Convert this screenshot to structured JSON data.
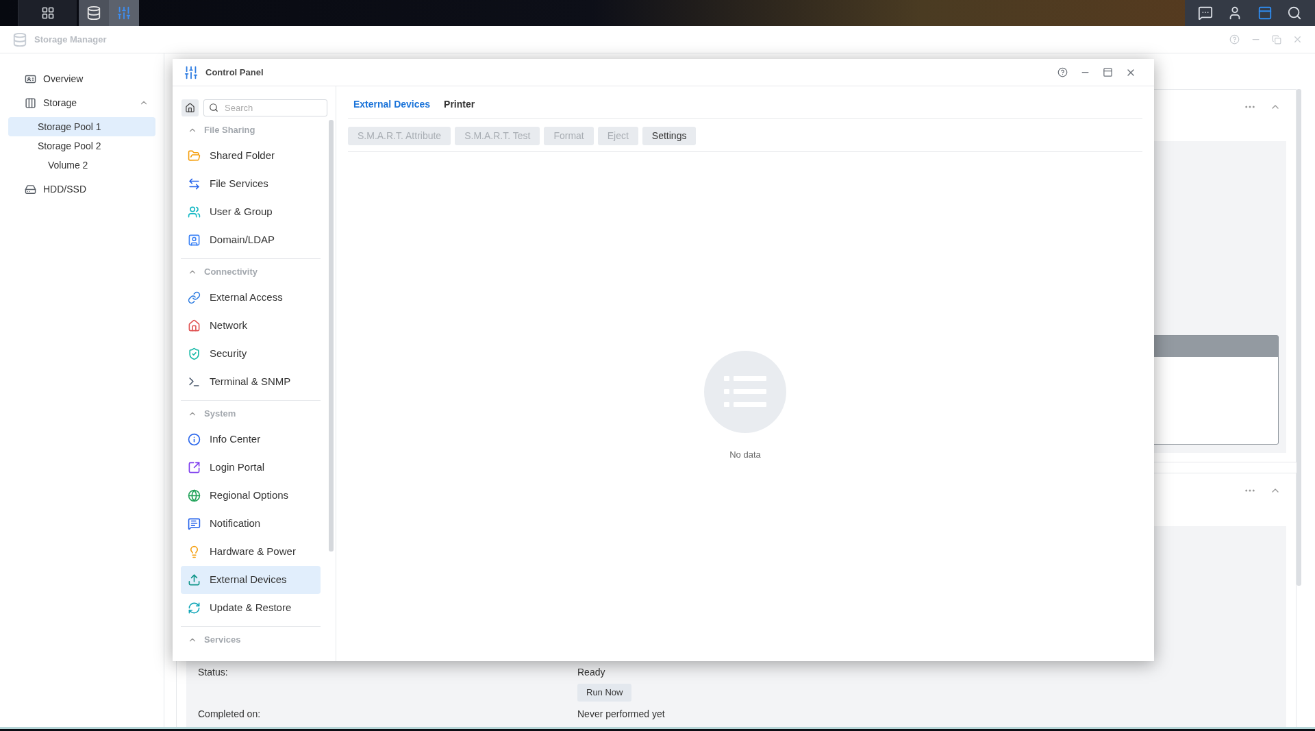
{
  "storage_manager": {
    "title": "Storage Manager",
    "sidebar": [
      {
        "label": "Overview",
        "selected": false
      },
      {
        "label": "Storage",
        "selected": false,
        "expanded": true,
        "children": [
          {
            "label": "Storage Pool 1",
            "selected": true
          },
          {
            "label": "Storage Pool 2",
            "selected": false,
            "children": [
              {
                "label": "Volume 2",
                "selected": false
              }
            ]
          }
        ]
      },
      {
        "label": "HDD/SSD",
        "selected": false
      }
    ],
    "details": [
      {
        "label": "Status:",
        "value": "Ready",
        "button": "Run Now"
      },
      {
        "label": "Completed on:",
        "value": "Never performed yet"
      }
    ]
  },
  "control_panel": {
    "title": "Control Panel",
    "search": {
      "placeholder": "Search"
    },
    "sections": [
      {
        "title": "File Sharing",
        "expanded": true,
        "items": [
          {
            "label": "Shared Folder",
            "selected": false
          },
          {
            "label": "File Services",
            "selected": false
          },
          {
            "label": "User & Group",
            "selected": false
          },
          {
            "label": "Domain/LDAP",
            "selected": false
          }
        ]
      },
      {
        "title": "Connectivity",
        "expanded": true,
        "items": [
          {
            "label": "External Access",
            "selected": false
          },
          {
            "label": "Network",
            "selected": false
          },
          {
            "label": "Security",
            "selected": false
          },
          {
            "label": "Terminal & SNMP",
            "selected": false
          }
        ]
      },
      {
        "title": "System",
        "expanded": true,
        "items": [
          {
            "label": "Info Center",
            "selected": false
          },
          {
            "label": "Login Portal",
            "selected": false
          },
          {
            "label": "Regional Options",
            "selected": false
          },
          {
            "label": "Notification",
            "selected": false
          },
          {
            "label": "Hardware & Power",
            "selected": false
          },
          {
            "label": "External Devices",
            "selected": true
          },
          {
            "label": "Update & Restore",
            "selected": false
          }
        ]
      },
      {
        "title": "Services",
        "expanded": true
      }
    ],
    "tabs": [
      {
        "label": "External Devices",
        "selected": true
      },
      {
        "label": "Printer",
        "selected": false
      }
    ],
    "toolbar": [
      {
        "label": "S.M.A.R.T. Attribute",
        "disabled": true
      },
      {
        "label": "S.M.A.R.T. Test",
        "disabled": true
      },
      {
        "label": "Format",
        "disabled": true
      },
      {
        "label": "Eject",
        "disabled": true
      },
      {
        "label": "Settings",
        "disabled": false
      }
    ],
    "empty_text": "No data"
  }
}
